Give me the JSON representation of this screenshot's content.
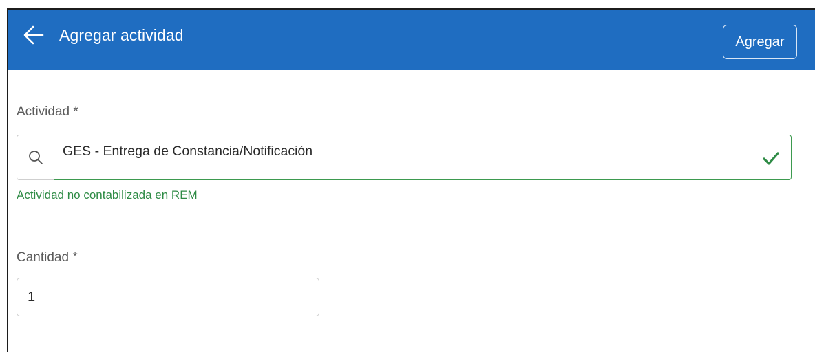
{
  "header": {
    "title": "Agregar actividad",
    "back_icon": "arrow-left-icon",
    "add_button_label": "Agregar",
    "background_color": "#1f6dc1"
  },
  "form": {
    "activity": {
      "label": "Actividad *",
      "value": "GES - Entrega de Constancia/Notificación",
      "search_icon": "search-icon",
      "status_icon": "check-icon",
      "hint": "Actividad no contabilizada en REM",
      "valid_color": "#3d9a4f"
    },
    "quantity": {
      "label": "Cantidad *",
      "value": "1"
    }
  }
}
